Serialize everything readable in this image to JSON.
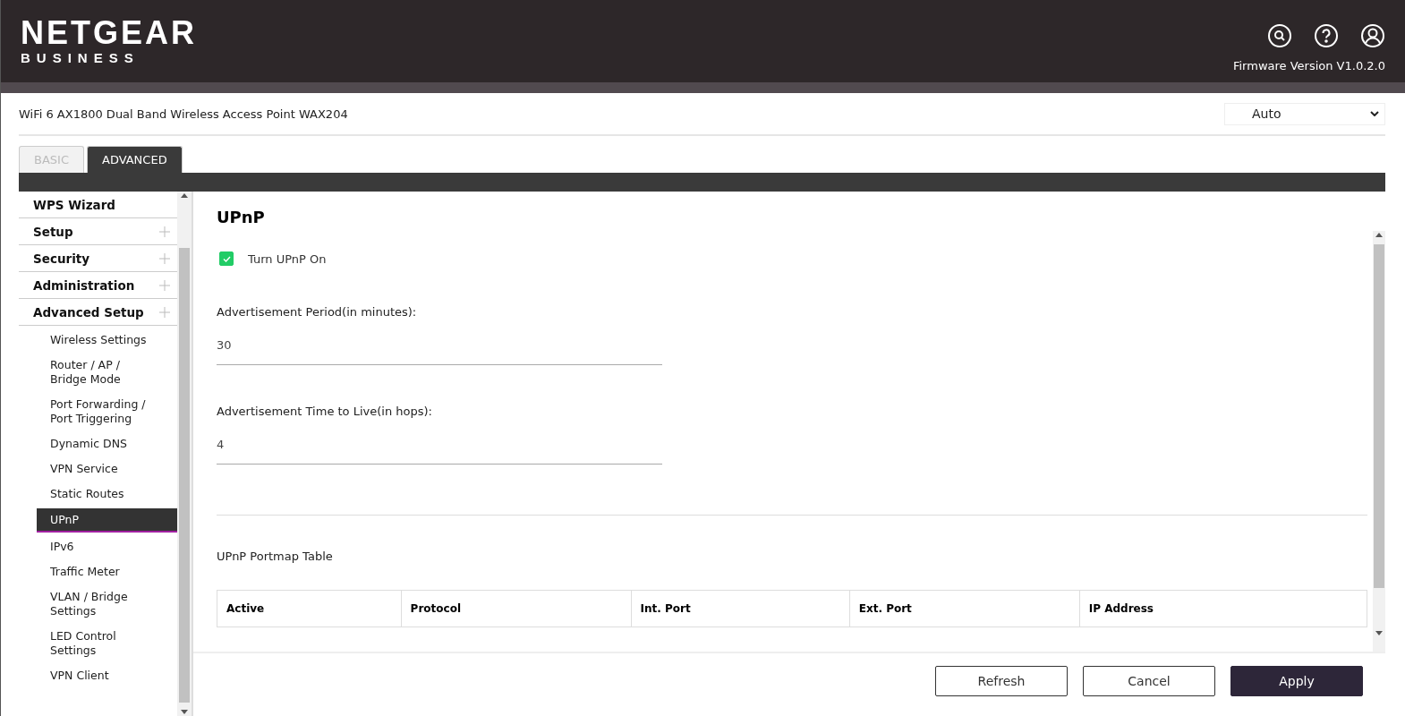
{
  "header": {
    "brand": "NETGEAR",
    "brand_sub": "BUSINESS",
    "firmware": "Firmware Version V1.0.2.0"
  },
  "device": {
    "name": "WiFi 6 AX1800 Dual Band Wireless Access Point WAX204",
    "language": "Auto"
  },
  "tabs": [
    {
      "label": "BASIC",
      "selected": false
    },
    {
      "label": "ADVANCED",
      "selected": true
    }
  ],
  "sidebar": {
    "items": [
      {
        "label": "WPS Wizard",
        "kind": "link"
      },
      {
        "label": "Setup",
        "kind": "group"
      },
      {
        "label": "Security",
        "kind": "group"
      },
      {
        "label": "Administration",
        "kind": "group"
      },
      {
        "label": "Advanced Setup",
        "kind": "group",
        "children": [
          {
            "label": "Wireless Settings",
            "selected": false
          },
          {
            "label": "Router / AP / Bridge Mode",
            "selected": false
          },
          {
            "label": "Port Forwarding / Port Triggering",
            "selected": false
          },
          {
            "label": "Dynamic DNS",
            "selected": false
          },
          {
            "label": "VPN Service",
            "selected": false
          },
          {
            "label": "Static Routes",
            "selected": false
          },
          {
            "label": "UPnP",
            "selected": true
          },
          {
            "label": "IPv6",
            "selected": false
          },
          {
            "label": "Traffic Meter",
            "selected": false
          },
          {
            "label": "VLAN / Bridge Settings",
            "selected": false
          },
          {
            "label": "LED Control Settings",
            "selected": false
          },
          {
            "label": "VPN Client",
            "selected": false
          }
        ]
      }
    ]
  },
  "page": {
    "title": "UPnP",
    "toggle": {
      "label": "Turn UPnP On",
      "checked": true
    },
    "fields": [
      {
        "label": "Advertisement Period(in minutes):",
        "value": "30"
      },
      {
        "label": "Advertisement Time to Live(in hops):",
        "value": "4"
      }
    ],
    "table": {
      "title": "UPnP Portmap Table",
      "columns": [
        "Active",
        "Protocol",
        "Int. Port",
        "Ext. Port",
        "IP Address"
      ]
    }
  },
  "buttons": [
    {
      "label": "Refresh",
      "kind": "secondary"
    },
    {
      "label": "Cancel",
      "kind": "secondary"
    },
    {
      "label": "Apply",
      "kind": "primary"
    }
  ]
}
